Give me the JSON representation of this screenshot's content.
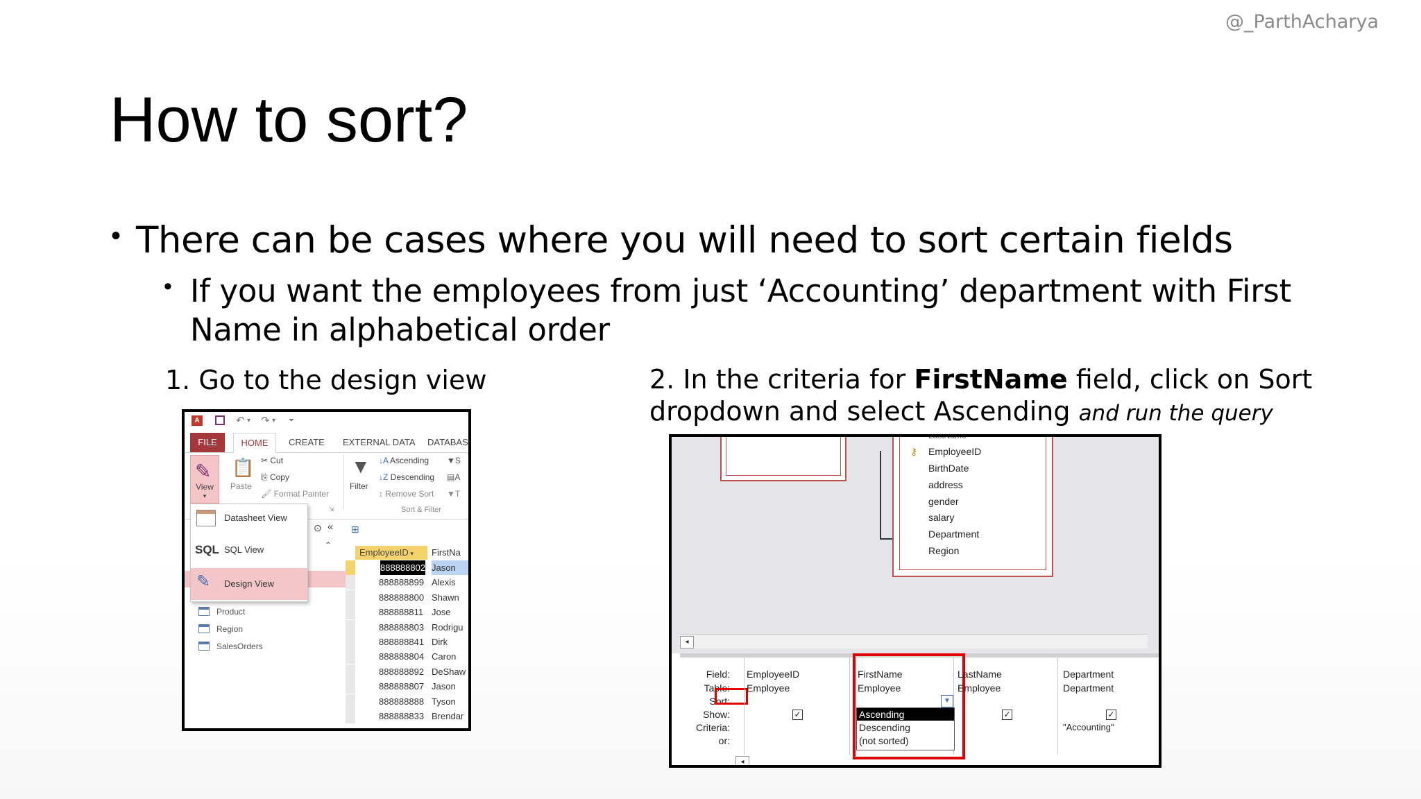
{
  "watermark": "@_ParthAcharya",
  "title": "How to sort?",
  "bullet1": "There can be cases where you will need to sort certain fields",
  "bullet2": "If you want the employees from just ‘Accounting’ department with First Name in alphabetical order",
  "step1": "1. Go to the design view",
  "step2": {
    "prefix": "2. In the criteria for ",
    "bold": "FirstName",
    "middle": " field, click on Sort dropdown and select Ascending ",
    "italic": "and run the query"
  },
  "access_window": {
    "tabs": [
      "FILE",
      "HOME",
      "CREATE",
      "EXTERNAL DATA",
      "DATABAS"
    ],
    "ribbon": {
      "view_label": "View",
      "paste_label": "Paste",
      "cut_label": "Cut",
      "copy_label": "Copy",
      "format_painter_label": "Format Painter",
      "filter_label": "Filter",
      "ascending_label": "Ascending",
      "descending_label": "Descending",
      "remove_sort_label": "Remove Sort",
      "sort_filter_group": "Sort & Filter"
    },
    "view_menu": [
      "Datasheet View",
      "SQL View",
      "Design View"
    ],
    "nav_items": [
      "Product",
      "Region",
      "SalesOrders"
    ],
    "grid_headers": [
      "EmployeeID",
      "FirstNa"
    ],
    "grid_rows": [
      [
        "888888802",
        "Jason"
      ],
      [
        "888888899",
        "Alexis"
      ],
      [
        "888888800",
        "Shawn"
      ],
      [
        "888888811",
        "Jose"
      ],
      [
        "888888803",
        "Rodrigu"
      ],
      [
        "888888841",
        "Dirk"
      ],
      [
        "888888804",
        "Caron"
      ],
      [
        "888888892",
        "DeShaw"
      ],
      [
        "888888807",
        "Jason"
      ],
      [
        "888888888",
        "Tyson"
      ],
      [
        "888888833",
        "Brendar"
      ]
    ]
  },
  "query_design": {
    "table_fields": [
      "LastName",
      "EmployeeID",
      "BirthDate",
      "address",
      "gender",
      "salary",
      "Department",
      "Region"
    ],
    "row_labels": [
      "Field:",
      "Table:",
      "Sort:",
      "Show:",
      "Criteria:",
      "or:"
    ],
    "columns": [
      {
        "field": "EmployeeID",
        "table": "Employee",
        "show": true,
        "criteria": ""
      },
      {
        "field": "FirstName",
        "table": "Employee",
        "show": true,
        "criteria": ""
      },
      {
        "field": "LastName",
        "table": "Employee",
        "show": true,
        "criteria": ""
      },
      {
        "field": "Department",
        "table": "Department",
        "show": true,
        "criteria": "\"Accounting\""
      }
    ],
    "sort_options": [
      "Ascending",
      "Descending",
      "(not sorted)"
    ],
    "highlight_color": "#e00000"
  }
}
